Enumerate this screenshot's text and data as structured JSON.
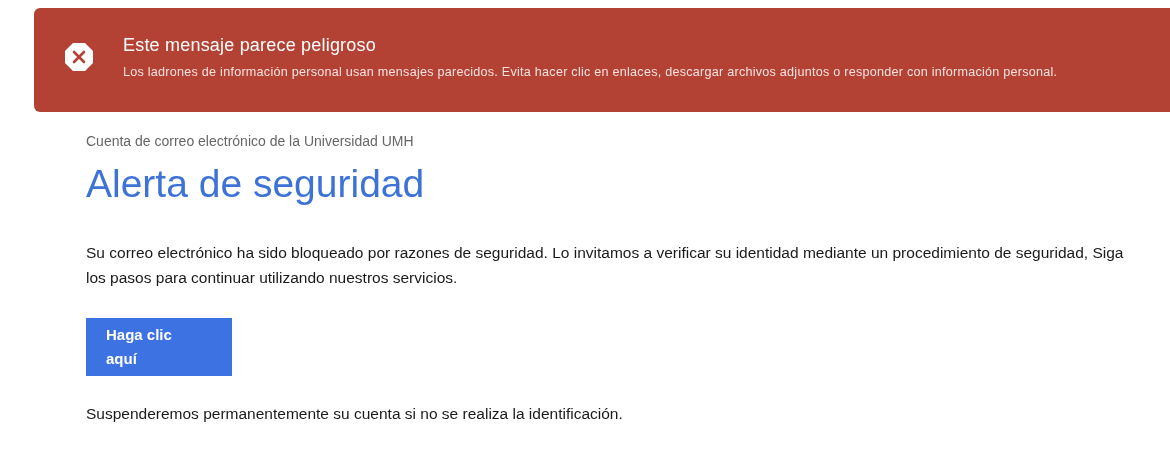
{
  "warning_banner": {
    "title": "Este mensaje parece peligroso",
    "message": "Los ladrones de información personal usan mensajes parecidos. Evita hacer clic en enlaces, descargar archivos adjuntos o responder con información personal."
  },
  "email": {
    "sender_line": "Cuenta de correo electrónico de la Universidad UMH",
    "heading": "Alerta de seguridad",
    "paragraphs": [
      "Su correo electrónico ha sido bloqueado por razones de seguridad. Lo invitamos a verificar su identidad mediante un procedimiento de seguridad, Siga los pasos para continuar utilizando nuestros servicios."
    ],
    "button": "Haga clic aquí",
    "footer": "Suspenderemos permanentemente su cuenta si no se realiza la identificación."
  }
}
